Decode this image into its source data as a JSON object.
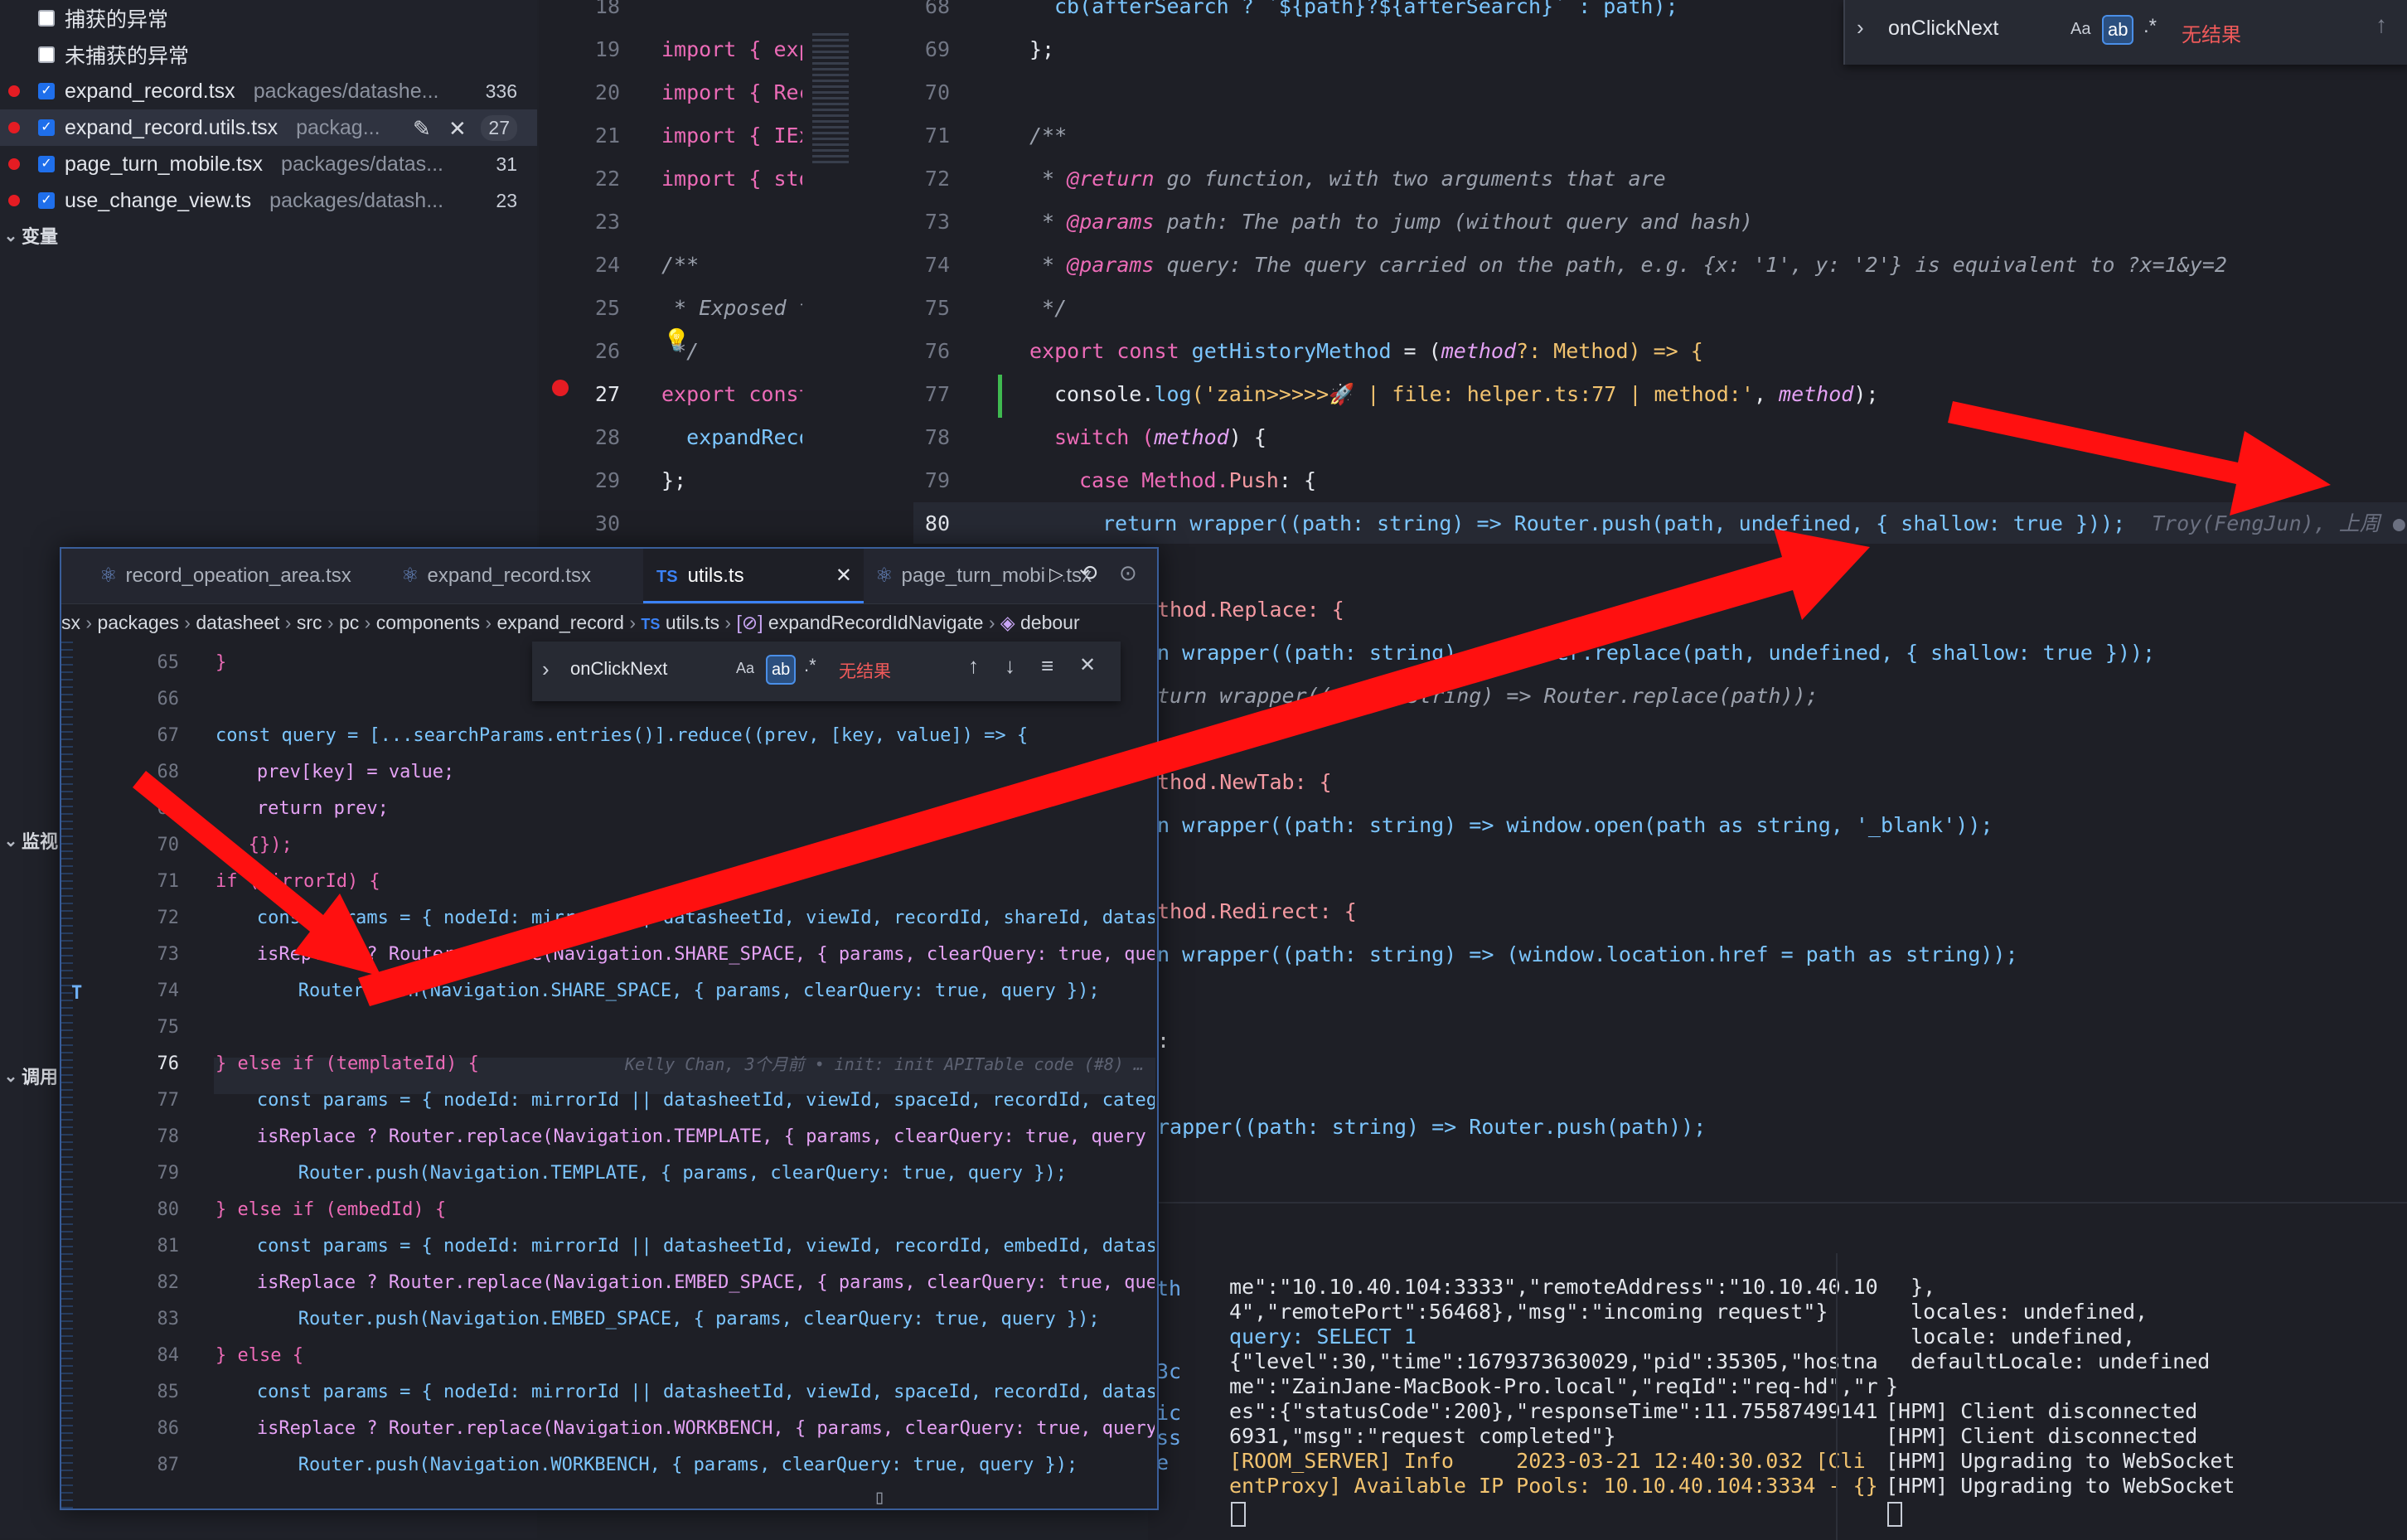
{
  "sidebar": {
    "exceptions": [
      {
        "label": "捕获的异常",
        "checked": false
      },
      {
        "label": "未捕获的异常",
        "checked": false
      }
    ],
    "breakpoints": [
      {
        "file": "expand_record.tsx",
        "path": "packages/datashe...",
        "count": "336",
        "active": false
      },
      {
        "file": "expand_record.utils.tsx",
        "path": "packag...",
        "count": "27",
        "active": true
      },
      {
        "file": "page_turn_mobile.tsx",
        "path": "packages/datas...",
        "count": "31",
        "active": false
      },
      {
        "file": "use_change_view.ts",
        "path": "packages/datash...",
        "count": "23",
        "active": false
      }
    ],
    "variables_label": "变量",
    "watch_label": "监视",
    "callstack_label": "调用"
  },
  "mid_editor": {
    "lines": [
      {
        "n": "18",
        "t": ""
      },
      {
        "n": "19",
        "t": "import { expandR"
      },
      {
        "n": "20",
        "t": "import { Record"
      },
      {
        "n": "21",
        "t": "import { IExpanc"
      },
      {
        "n": "22",
        "t": "import { store }"
      },
      {
        "n": "23",
        "t": ""
      },
      {
        "n": "24",
        "t": "/**"
      },
      {
        "n": "25",
        "t": " * Exposed to e"
      },
      {
        "n": "26",
        "t": " */"
      },
      {
        "n": "27",
        "t": "export const exp"
      },
      {
        "n": "28",
        "t": "  expandRecordIr"
      },
      {
        "n": "29",
        "t": "};"
      },
      {
        "n": "30",
        "t": ""
      }
    ]
  },
  "right_editor": {
    "find": {
      "query": "onClickNext",
      "aa": "Aa",
      "ab": "ab",
      "regex": ".*",
      "result": "无结果"
    },
    "blame": "Troy(FengJun), 上周 ●",
    "line_numbers": [
      "68",
      "69",
      "70",
      "71",
      "72",
      "73",
      "74",
      "75",
      "76",
      "77",
      "78",
      "79",
      "80"
    ],
    "l68": "cb(afterSearch ? `${path}?${afterSearch}` : path);",
    "l69": "};",
    "l71": "/**",
    "l72_tag": "@return",
    "l72_txt": " go function, with two arguments that are",
    "l73_tag": "@params",
    "l73_txt": " path: The path to jump (without query and hash)",
    "l74_tag": "@params",
    "l74_txt": " query: The query carried on the path, e.g. {x: '1', y: '2'} is equivalent to ?x=1&y=2",
    "l75": " */",
    "l76_a": "export const ",
    "l76_fn": "getHistoryMethod",
    "l76_b": " = (",
    "l76_param": "method",
    "l76_c": "?: Method) => {",
    "l77_a": "console.",
    "l77_fn": "log",
    "l77_str": "('zain>>>>>🚀 | file: helper.ts:77 | method:'",
    "l77_b": ", ",
    "l77_var": "method",
    "l77_c": ");",
    "l78_a": "switch (",
    "l78_var": "method",
    "l78_b": ") {",
    "l79_a": "case Method.",
    "l79_prop": "Push",
    "l79_b": ": {",
    "l80": "return wrapper((path: string) => Router.push(path, undefined, { shallow: true }));",
    "r1": "thod.Replace: {",
    "r2": "n wrapper((path: string) => Router.replace(path, undefined, { shallow: true }));",
    "r3": "turn wrapper((path: string) => Router.replace(path));",
    "r4": "thod.NewTab: {",
    "r5": "n wrapper((path: string) => window.open(path as string, '_blank'));",
    "r6": "thod.Redirect: {",
    "r7": "n wrapper((path: string) => (window.location.href = path as string));",
    "r8": ":",
    "r9": "rapper((path: string) => Router.push(path));"
  },
  "terminal": {
    "left_col": [
      "th",
      "",
      "",
      "3c",
      "",
      "ic",
      "ss",
      "e"
    ],
    "mid": [
      "me\":\"10.10.40.104:3333\",\"remoteAddress\":\"10.10.40.10",
      "4\",\"remotePort\":56468},\"msg\":\"incoming request\"}",
      "query: SELECT 1",
      "{\"level\":30,\"time\":1679373630029,\"pid\":35305,\"hostna",
      "me\":\"ZainJane-MacBook-Pro.local\",\"reqId\":\"req-hd\",\"r",
      "es\":{\"statusCode\":200},\"responseTime\":11.75587499141",
      "6931,\"msg\":\"request completed\"}",
      "[ROOM_SERVER] Info     2023-03-21 12:40:30.032 [Cli",
      "entProxy] Available IP Pools: 10.10.40.104:3334 - {}"
    ],
    "right": [
      "  },",
      "  locales: undefined,",
      "  locale: undefined,",
      "  defaultLocale: undefined",
      "}",
      "[HPM] Client disconnected",
      "[HPM] Client disconnected",
      "[HPM] Upgrading to WebSocket",
      "[HPM] Upgrading to WebSocket"
    ]
  },
  "overlay": {
    "tabs": [
      "record_opeation_area.tsx",
      "expand_record.tsx",
      "utils.ts",
      "page_turn_mobile.tsx"
    ],
    "ts_badge": "TS",
    "breadcrumb": [
      "sx",
      "packages",
      "datasheet",
      "src",
      "pc",
      "components",
      "expand_record",
      "utils.ts",
      "expandRecordIdNavigate",
      "debour"
    ],
    "find": {
      "query": "onClickNext",
      "aa": "Aa",
      "ab": "ab",
      "regex": ".*",
      "result": "无结果"
    },
    "line_numbers": [
      "65",
      "66",
      "67",
      "68",
      "69",
      "70",
      "71",
      "72",
      "73",
      "74",
      "75",
      "76",
      "77",
      "78",
      "79",
      "80",
      "81",
      "82",
      "83",
      "84",
      "85",
      "86",
      "87"
    ],
    "lines": [
      "}",
      "",
      "const query = [...searchParams.entries()].reduce((prev, [key, value]) => {",
      "  prev[key] = value;",
      "  return prev;",
      "}, {});",
      "if (mirrorId) {",
      "  const params = { nodeId: mirrorId || datasheetId, viewId, recordId, shareId, datasheetId",
      "  isReplace ? Router.replace(Navigation.SHARE_SPACE, { params, clearQuery: true, query }) :",
      "    Router.push(Navigation.SHARE_SPACE, { params, clearQuery: true, query });",
      "",
      "} else if (templateId) {",
      "  const params = { nodeId: mirrorId || datasheetId, viewId, spaceId, recordId, categoryId,",
      "  isReplace ? Router.replace(Navigation.TEMPLATE, { params, clearQuery: true, query }) :",
      "    Router.push(Navigation.TEMPLATE, { params, clearQuery: true, query });",
      "} else if (embedId) {",
      "  const params = { nodeId: mirrorId || datasheetId, viewId, recordId, embedId, datasheetId",
      "  isReplace ? Router.replace(Navigation.EMBED_SPACE, { params, clearQuery: true, query }) :",
      "    Router.push(Navigation.EMBED_SPACE, { params, clearQuery: true, query });",
      "} else {",
      "  const params = { nodeId: mirrorId || datasheetId, viewId, spaceId, recordId, datasheetId",
      "  isReplace ? Router.replace(Navigation.WORKBENCH, { params, clearQuery: true, query }) :",
      "    Router.push(Navigation.WORKBENCH, { params, clearQuery: true, query });"
    ],
    "blame_76": "Kelly Chan, 3个月前 • init: init APITable code (#8) …"
  },
  "colors": {
    "arrow": "#ff1010",
    "accent": "#3b82f6",
    "breakpoint": "#e51c23"
  }
}
